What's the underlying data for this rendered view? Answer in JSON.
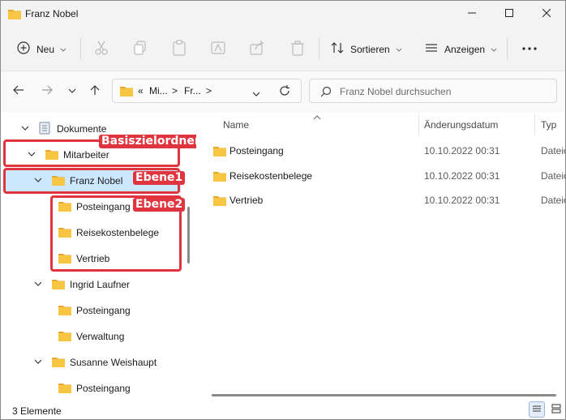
{
  "window": {
    "title": "Franz Nobel"
  },
  "window_controls": {
    "minimize_icon": "minimize-icon",
    "maximize_icon": "maximize-icon",
    "close_icon": "close-icon"
  },
  "toolbar": {
    "new_label": "Neu",
    "sort_label": "Sortieren",
    "view_label": "Anzeigen",
    "more_icon": "more-icon"
  },
  "address": {
    "segments": [
      "«",
      "Mi...",
      ">",
      "Fr...",
      ">"
    ],
    "seg1": "«",
    "seg2": "Mi...",
    "seg3": "Fr...",
    "search_placeholder": "Franz Nobel durchsuchen"
  },
  "tree": {
    "root": "Dokumente",
    "items": [
      {
        "label": "Mitarbeiter"
      },
      {
        "label": "Franz Nobel"
      },
      {
        "label": "Posteingang"
      },
      {
        "label": "Reisekostenbelege"
      },
      {
        "label": "Vertrieb"
      },
      {
        "label": "Ingrid Laufner"
      },
      {
        "label": "Posteingang"
      },
      {
        "label": "Verwaltung"
      },
      {
        "label": "Susanne Weishaupt"
      },
      {
        "label": "Posteingang"
      }
    ]
  },
  "columns": {
    "name": "Name",
    "date": "Änderungsdatum",
    "type": "Typ"
  },
  "files": [
    {
      "name": "Posteingang",
      "date": "10.10.2022 00:31",
      "type": "Dateio"
    },
    {
      "name": "Reisekostenbelege",
      "date": "10.10.2022 00:31",
      "type": "Dateio"
    },
    {
      "name": "Vertrieb",
      "date": "10.10.2022 00:31",
      "type": "Dateio"
    }
  ],
  "status": {
    "count": "3 Elemente"
  },
  "annotations": {
    "base": "Basiszielordner",
    "level1": "Ebene1",
    "level2": "Ebene2"
  },
  "colors": {
    "annotation": "#e0353f",
    "folder": "#f6c342",
    "selection": "#cce8ff"
  }
}
